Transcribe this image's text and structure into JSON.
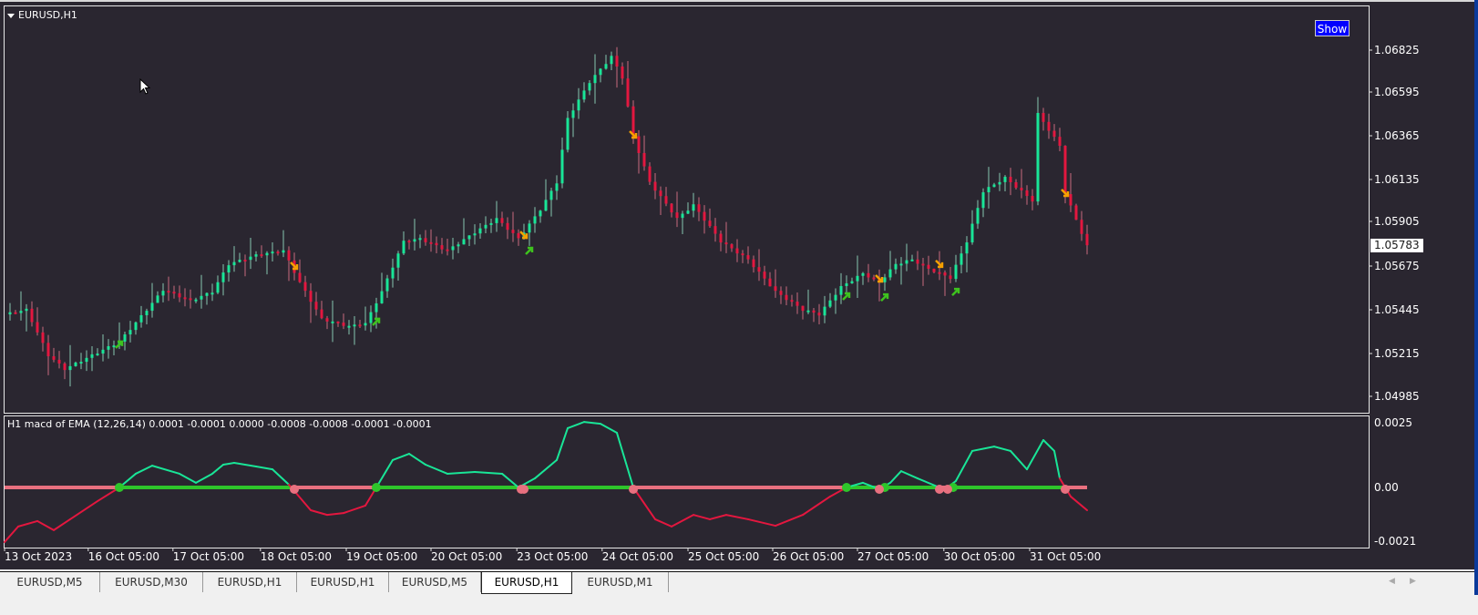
{
  "window": {
    "symbol_label": "EURUSD,H1",
    "show_button": "Show"
  },
  "price_axis": {
    "labels": [
      "1.06825",
      "1.06595",
      "1.06365",
      "1.06135",
      "1.05905",
      "1.05675",
      "1.05445",
      "1.05215",
      "1.04985"
    ],
    "current_price": "1.05783"
  },
  "indicator": {
    "title": "H1 macd of EMA (12,26,14) 0.0001 -0.0001 0.0000 -0.0008 -0.0008 -0.0001 -0.0001",
    "axis_labels": [
      "0.0025",
      "0.00",
      "-0.0021"
    ]
  },
  "time_axis": {
    "labels": [
      "13 Oct 2023",
      "16 Oct 05:00",
      "17 Oct 05:00",
      "18 Oct 05:00",
      "19 Oct 05:00",
      "20 Oct 05:00",
      "23 Oct 05:00",
      "24 Oct 05:00",
      "25 Oct 05:00",
      "26 Oct 05:00",
      "27 Oct 05:00",
      "30 Oct 05:00",
      "31 Oct 05:00"
    ],
    "label_bars": [
      0,
      15.3,
      30.8,
      46.8,
      62.5,
      78,
      93.7,
      109.3,
      125,
      140.5,
      156,
      171.8,
      187.5
    ]
  },
  "tabs": [
    {
      "label": "EURUSD,M5",
      "active": false
    },
    {
      "label": "EURUSD,M30",
      "active": false
    },
    {
      "label": "EURUSD,H1",
      "active": false
    },
    {
      "label": "EURUSD,H1",
      "active": false
    },
    {
      "label": "EURUSD,M5",
      "active": false
    },
    {
      "label": "EURUSD,H1",
      "active": true
    },
    {
      "label": "EURUSD,M1",
      "active": false
    }
  ],
  "colors": {
    "bull": "#19e597",
    "bear": "#e3173f",
    "bull_wick": "#9ef0cf",
    "bear_wick": "#f07a92",
    "arrow_down": "#f5a000",
    "arrow_up": "#3ec21e",
    "zero_neg": "#e8707f",
    "zero_pos": "#2ec52a",
    "background": "#2a2630"
  },
  "chart_data": [
    {
      "type": "candlestick",
      "title": "EURUSD,H1",
      "ylim": [
        1.049,
        1.0695
      ],
      "price_path": [
        [
          0,
          1.05421
        ],
        [
          4,
          1.05446
        ],
        [
          8,
          1.05204
        ],
        [
          11,
          1.05131
        ],
        [
          16,
          1.05204
        ],
        [
          21,
          1.05276
        ],
        [
          26,
          1.05446
        ],
        [
          29,
          1.05552
        ],
        [
          34,
          1.05494
        ],
        [
          38,
          1.05542
        ],
        [
          41,
          1.05688
        ],
        [
          46,
          1.05736
        ],
        [
          51,
          1.0576
        ],
        [
          54,
          1.05591
        ],
        [
          58,
          1.05397
        ],
        [
          63,
          1.05358
        ],
        [
          66,
          1.05373
        ],
        [
          69,
          1.05542
        ],
        [
          73,
          1.05809
        ],
        [
          76,
          1.05823
        ],
        [
          81,
          1.0576
        ],
        [
          86,
          1.05857
        ],
        [
          90,
          1.0593
        ],
        [
          94,
          1.05823
        ],
        [
          98,
          1.05978
        ],
        [
          101,
          1.06123
        ],
        [
          103,
          1.06462
        ],
        [
          107,
          1.06656
        ],
        [
          111,
          1.06791
        ],
        [
          113,
          1.0668
        ],
        [
          115,
          1.06365
        ],
        [
          118,
          1.06123
        ],
        [
          123,
          1.0593
        ],
        [
          126,
          1.06002
        ],
        [
          131,
          1.05809
        ],
        [
          136,
          1.05712
        ],
        [
          141,
          1.05542
        ],
        [
          146,
          1.05446
        ],
        [
          149,
          1.05421
        ],
        [
          153,
          1.05567
        ],
        [
          157,
          1.05639
        ],
        [
          160,
          1.05591
        ],
        [
          163,
          1.05688
        ],
        [
          166,
          1.05712
        ],
        [
          169,
          1.05663
        ],
        [
          173,
          1.05615
        ],
        [
          176,
          1.05809
        ],
        [
          179,
          1.06075
        ],
        [
          183,
          1.06147
        ],
        [
          185,
          1.06099
        ],
        [
          188,
          1.06026
        ],
        [
          189,
          1.06486
        ],
        [
          193,
          1.06317
        ],
        [
          194,
          1.06065
        ],
        [
          198,
          1.05783
        ]
      ],
      "signals_down": [
        [
          53,
          1.05678
        ],
        [
          95,
          1.05842
        ],
        [
          115,
          1.06375
        ],
        [
          160,
          1.0561
        ],
        [
          171,
          1.05688
        ],
        [
          194,
          1.06065
        ]
      ],
      "signals_up": [
        [
          21,
          1.05262
        ],
        [
          68,
          1.05383
        ],
        [
          96,
          1.0576
        ],
        [
          154,
          1.05518
        ],
        [
          161,
          1.05513
        ],
        [
          174,
          1.05542
        ]
      ]
    },
    {
      "type": "line",
      "title": "H1 macd of EMA (12,26,14)",
      "ylim": [
        -0.0021,
        0.0025
      ],
      "macd": [
        [
          0,
          -0.00211
        ],
        [
          2.5,
          -0.00151
        ],
        [
          6,
          -0.0013
        ],
        [
          9,
          -0.00165
        ],
        [
          12,
          -0.00123
        ],
        [
          17,
          -0.00053
        ],
        [
          21,
          0
        ],
        [
          24,
          0.00053
        ],
        [
          27,
          0.00084
        ],
        [
          32,
          0.00053
        ],
        [
          35,
          0.00018
        ],
        [
          38,
          0.00053
        ],
        [
          40,
          0.00088
        ],
        [
          42,
          0.00095
        ],
        [
          46,
          0.00081
        ],
        [
          49,
          0.0007
        ],
        [
          52,
          0.00011
        ],
        [
          56,
          -0.00088
        ],
        [
          59,
          -0.00106
        ],
        [
          62,
          -0.00099
        ],
        [
          66,
          -0.0007
        ],
        [
          68,
          0
        ],
        [
          71,
          0.00106
        ],
        [
          74,
          0.0013
        ],
        [
          77,
          0.00088
        ],
        [
          81,
          0.00053
        ],
        [
          86,
          0.0006
        ],
        [
          91,
          0.00053
        ],
        [
          94,
          0
        ],
        [
          97,
          0.00035
        ],
        [
          101,
          0.00106
        ],
        [
          103,
          0.00229
        ],
        [
          106,
          0.00253
        ],
        [
          109,
          0.00246
        ],
        [
          112,
          0.00211
        ],
        [
          115,
          0
        ],
        [
          119,
          -0.00123
        ],
        [
          122,
          -0.00151
        ],
        [
          126,
          -0.00106
        ],
        [
          129,
          -0.00123
        ],
        [
          132,
          -0.00106
        ],
        [
          136,
          -0.00123
        ],
        [
          141,
          -0.00148
        ],
        [
          146,
          -0.00106
        ],
        [
          151,
          -0.00035
        ],
        [
          154,
          0
        ],
        [
          157,
          0.00018
        ],
        [
          160,
          -7e-05
        ],
        [
          162,
          0.00018
        ],
        [
          164,
          0.00063
        ],
        [
          167,
          0.00035
        ],
        [
          171,
          0
        ],
        [
          172,
          -7e-05
        ],
        [
          174,
          0.00025
        ],
        [
          177,
          0.00141
        ],
        [
          181,
          0.00158
        ],
        [
          184,
          0.00141
        ],
        [
          187,
          0.0007
        ],
        [
          190,
          0.00183
        ],
        [
          192,
          0.00141
        ],
        [
          193,
          0.00035
        ],
        [
          195,
          -0.00035
        ],
        [
          198,
          -0.00088
        ]
      ],
      "cross_up_bars": [
        21,
        68,
        154,
        161,
        173.5
      ],
      "cross_down_bars": [
        53,
        94.5,
        95,
        115,
        160,
        171,
        172.5,
        194
      ]
    }
  ]
}
